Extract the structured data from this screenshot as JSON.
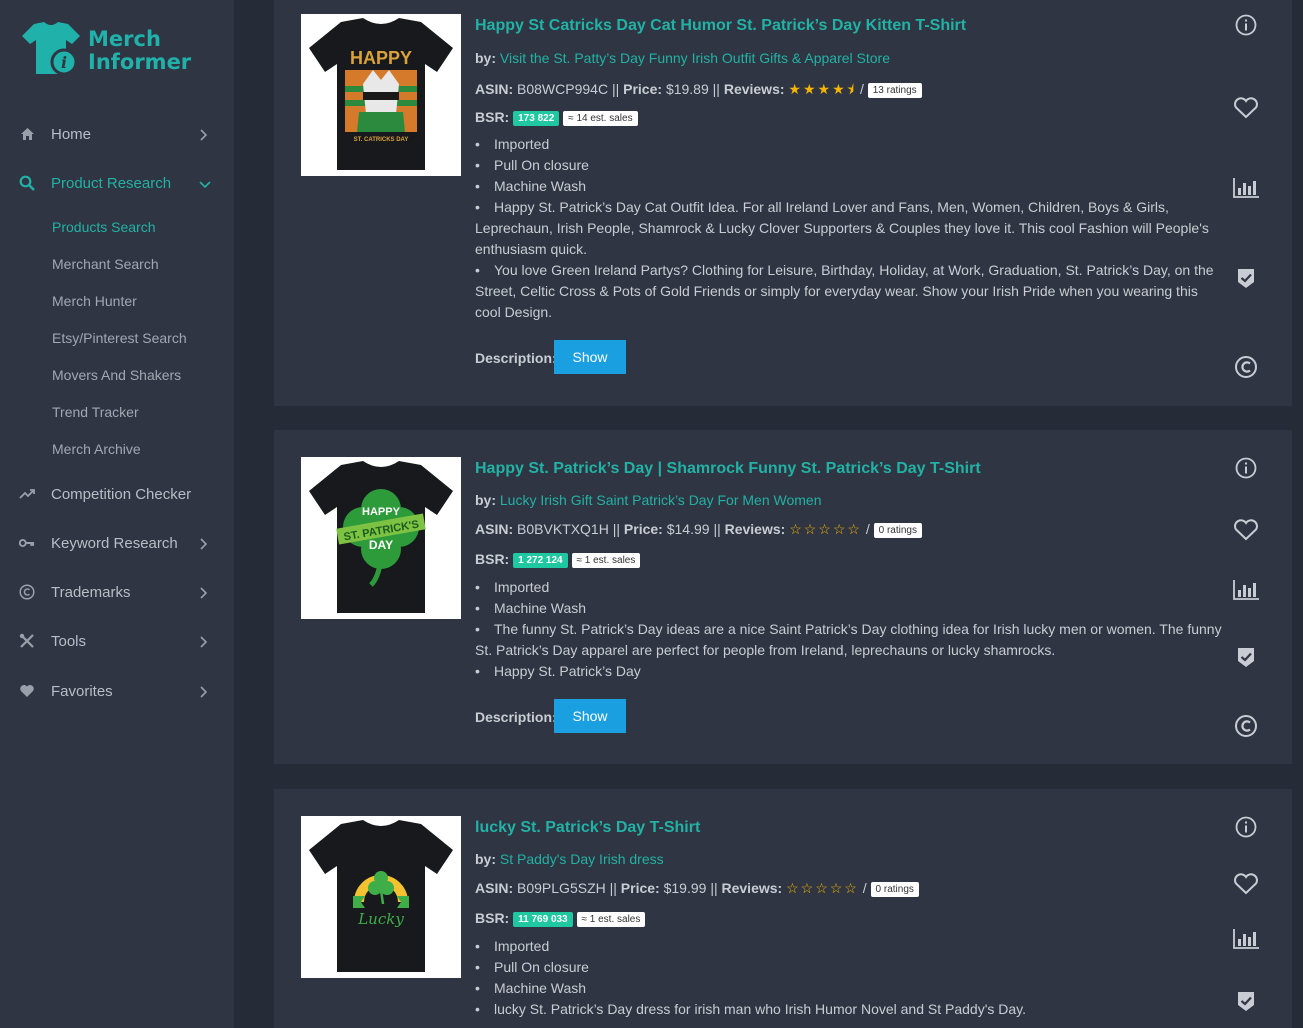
{
  "brand": {
    "line1": "Merch",
    "line2": "Informer",
    "accent": "#22b2a5"
  },
  "sidebar": {
    "items": [
      {
        "label": "Home",
        "icon": "home-icon"
      },
      {
        "label": "Product Research",
        "icon": "search-icon"
      },
      {
        "label": "Competition Checker",
        "icon": "trend-icon"
      },
      {
        "label": "Keyword Research",
        "icon": "key-icon"
      },
      {
        "label": "Trademarks",
        "icon": "copyright-icon"
      },
      {
        "label": "Tools",
        "icon": "tools-icon"
      },
      {
        "label": "Favorites",
        "icon": "heart-icon"
      }
    ],
    "subitems": [
      "Products Search",
      "Merchant Search",
      "Merch Hunter",
      "Etsy/Pinterest Search",
      "Movers And Shakers",
      "Trend Tracker",
      "Merch Archive"
    ]
  },
  "labels": {
    "by": "by:",
    "asin": "ASIN:",
    "price": "Price:",
    "reviews": "Reviews:",
    "bsr": "BSR:",
    "description": "Description:",
    "show": "Show",
    "sep": "||",
    "slash": "/"
  },
  "products": [
    {
      "title": "Happy St Catricks Day Cat Humor St. Patrick’s Day Kitten T-Shirt",
      "brand": "Visit the St. Patty’s Day Funny Irish Outfit Gifts & Apparel Store",
      "asin": "B08WCP994C",
      "price": "$19.89",
      "rating": 4.5,
      "stars": "★★★★⯨",
      "ratings": "13 ratings",
      "bsr": "173 822",
      "sales": "≈ 14 est. sales",
      "bullets": [
        "Imported",
        "Pull On closure",
        "Machine Wash",
        "Happy St. Patrick’s Day Cat Outfit Idea. For all Ireland Lover and Fans, Men, Women, Children, Boys & Girls, Leprechaun, Irish People, Shamrock & Lucky Clover Supporters & Couples they love it. This cool Fashion will People's enthusiasm quick.",
        "You love Green Ireland Partys? Clothing for Leisure, Birthday, Holiday, at Work, Graduation, St. Patrick’s Day, on the Street, Celtic Cross & Pots of Gold Friends or simply for everyday wear. Show your Irish Pride when you wearing this cool Design."
      ],
      "shirt_text": "HAPPY",
      "shirt_sub": "ST. CATRICKS DAY"
    },
    {
      "title": "Happy St. Patrick’s Day | Shamrock Funny St. Patrick’s Day T-Shirt",
      "brand": "Lucky Irish Gift Saint Patrick’s Day For Men Women",
      "asin": "B0BVKTXQ1H",
      "price": "$14.99",
      "rating": 0,
      "stars": "☆☆☆☆☆",
      "ratings": "0 ratings",
      "bsr": "1 272 124",
      "sales": "≈ 1 est. sales",
      "bullets": [
        "Imported",
        "Machine Wash",
        "The funny St. Patrick’s Day ideas are a nice Saint Patrick’s Day clothing idea for Irish lucky men or women. The funny St. Patrick’s Day apparel are perfect for people from Ireland, leprechauns or lucky shamrocks.",
        "Happy St. Patrick’s Day"
      ],
      "shirt_text": "HAPPY",
      "shirt_sub": "ST. PATRICK'S"
    },
    {
      "title": "lucky St. Patrick’s Day T-Shirt",
      "brand": "St Paddy's Day Irish dress",
      "asin": "B09PLG5SZH",
      "price": "$19.99",
      "rating": 0,
      "stars": "☆☆☆☆☆",
      "ratings": "0 ratings",
      "bsr": "11 769 033",
      "sales": "≈ 1 est. sales",
      "bullets": [
        "Imported",
        "Pull On closure",
        "Machine Wash",
        "lucky St. Patrick’s Day dress for irish man who Irish Humor Novel and St Paddy's Day."
      ],
      "shirt_text": "Lucky"
    }
  ]
}
